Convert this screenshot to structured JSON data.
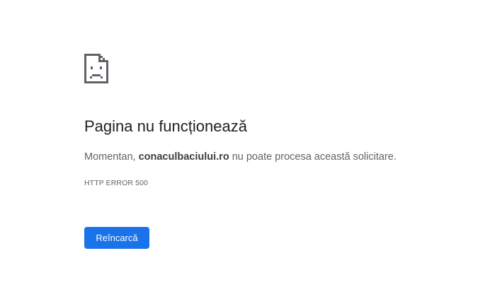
{
  "icon": "sad-page-icon",
  "colors": {
    "accent": "#1a73e8",
    "title_text": "#202124",
    "body_text": "#5f6368",
    "icon": "#5f6368"
  },
  "error": {
    "title": "Pagina nu funcționează",
    "message_prefix": "Momentan, ",
    "domain": "conaculbaciului.ro",
    "message_suffix": " nu poate procesa această solicitare.",
    "code": "HTTP ERROR 500"
  },
  "actions": {
    "reload_label": "Reîncarcă"
  }
}
